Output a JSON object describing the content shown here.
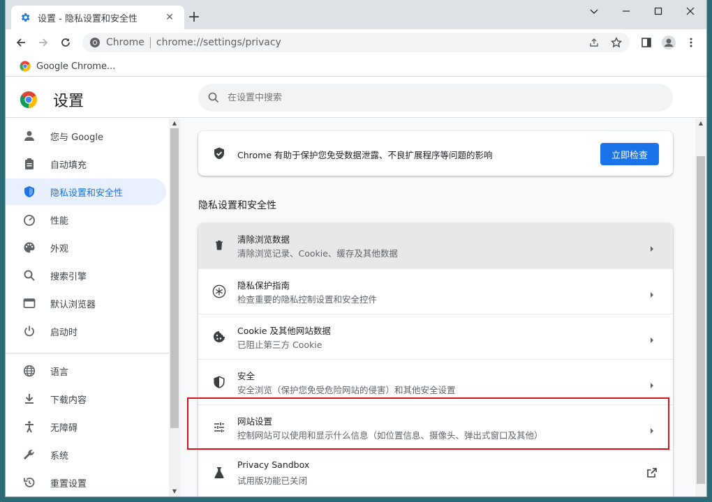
{
  "browser": {
    "tab_title": "设置 - 隐私设置和安全性",
    "tab_close": "✕",
    "new_tab": "+",
    "site_name": "Chrome",
    "url": "chrome://settings/privacy",
    "bookmark_label": "Google Chrome..."
  },
  "settings": {
    "title": "设置",
    "search_placeholder": "在设置中搜索"
  },
  "sidebar": {
    "items": [
      {
        "label": "您与 Google",
        "icon": "person-icon"
      },
      {
        "label": "自动填充",
        "icon": "clipboard-icon"
      },
      {
        "label": "隐私设置和安全性",
        "icon": "shield-icon",
        "active": true
      },
      {
        "label": "性能",
        "icon": "gauge-icon"
      },
      {
        "label": "外观",
        "icon": "palette-icon"
      },
      {
        "label": "搜索引擎",
        "icon": "search-icon"
      },
      {
        "label": "默认浏览器",
        "icon": "browser-icon"
      },
      {
        "label": "启动时",
        "icon": "power-icon"
      },
      {
        "label": "语言",
        "icon": "globe-icon"
      },
      {
        "label": "下载内容",
        "icon": "download-icon"
      },
      {
        "label": "无障碍",
        "icon": "accessibility-icon"
      },
      {
        "label": "系统",
        "icon": "wrench-icon"
      },
      {
        "label": "重置设置",
        "icon": "reset-icon"
      }
    ]
  },
  "safety_check": {
    "text": "Chrome 有助于保护您免受数据泄露、不良扩展程序等问题的影响",
    "button": "立即检查"
  },
  "privacy_section": {
    "title": "隐私设置和安全性",
    "rows": [
      {
        "title": "清除浏览数据",
        "subtitle": "清除浏览记录、Cookie、缓存及其他数据",
        "icon": "trash-icon"
      },
      {
        "title": "隐私保护指南",
        "subtitle": "检查重要的隐私控制设置和安全控件",
        "icon": "privacy-guide-icon"
      },
      {
        "title": "Cookie 及其他网站数据",
        "subtitle": "已阻止第三方 Cookie",
        "icon": "cookie-icon"
      },
      {
        "title": "安全",
        "subtitle": "安全浏览（保护您免受危险网站的侵害）和其他安全设置",
        "icon": "shield-half-icon"
      },
      {
        "title": "网站设置",
        "subtitle": "控制网站可以使用和显示什么信息（如位置信息、摄像头、弹出式窗口及其他）",
        "icon": "tune-icon"
      },
      {
        "title": "Privacy Sandbox",
        "subtitle": "试用版功能已关闭",
        "icon": "flask-icon"
      }
    ]
  },
  "colors": {
    "accent": "#1a73e8",
    "active_bg": "#e8f0fe",
    "highlight_border": "#d3141c"
  }
}
